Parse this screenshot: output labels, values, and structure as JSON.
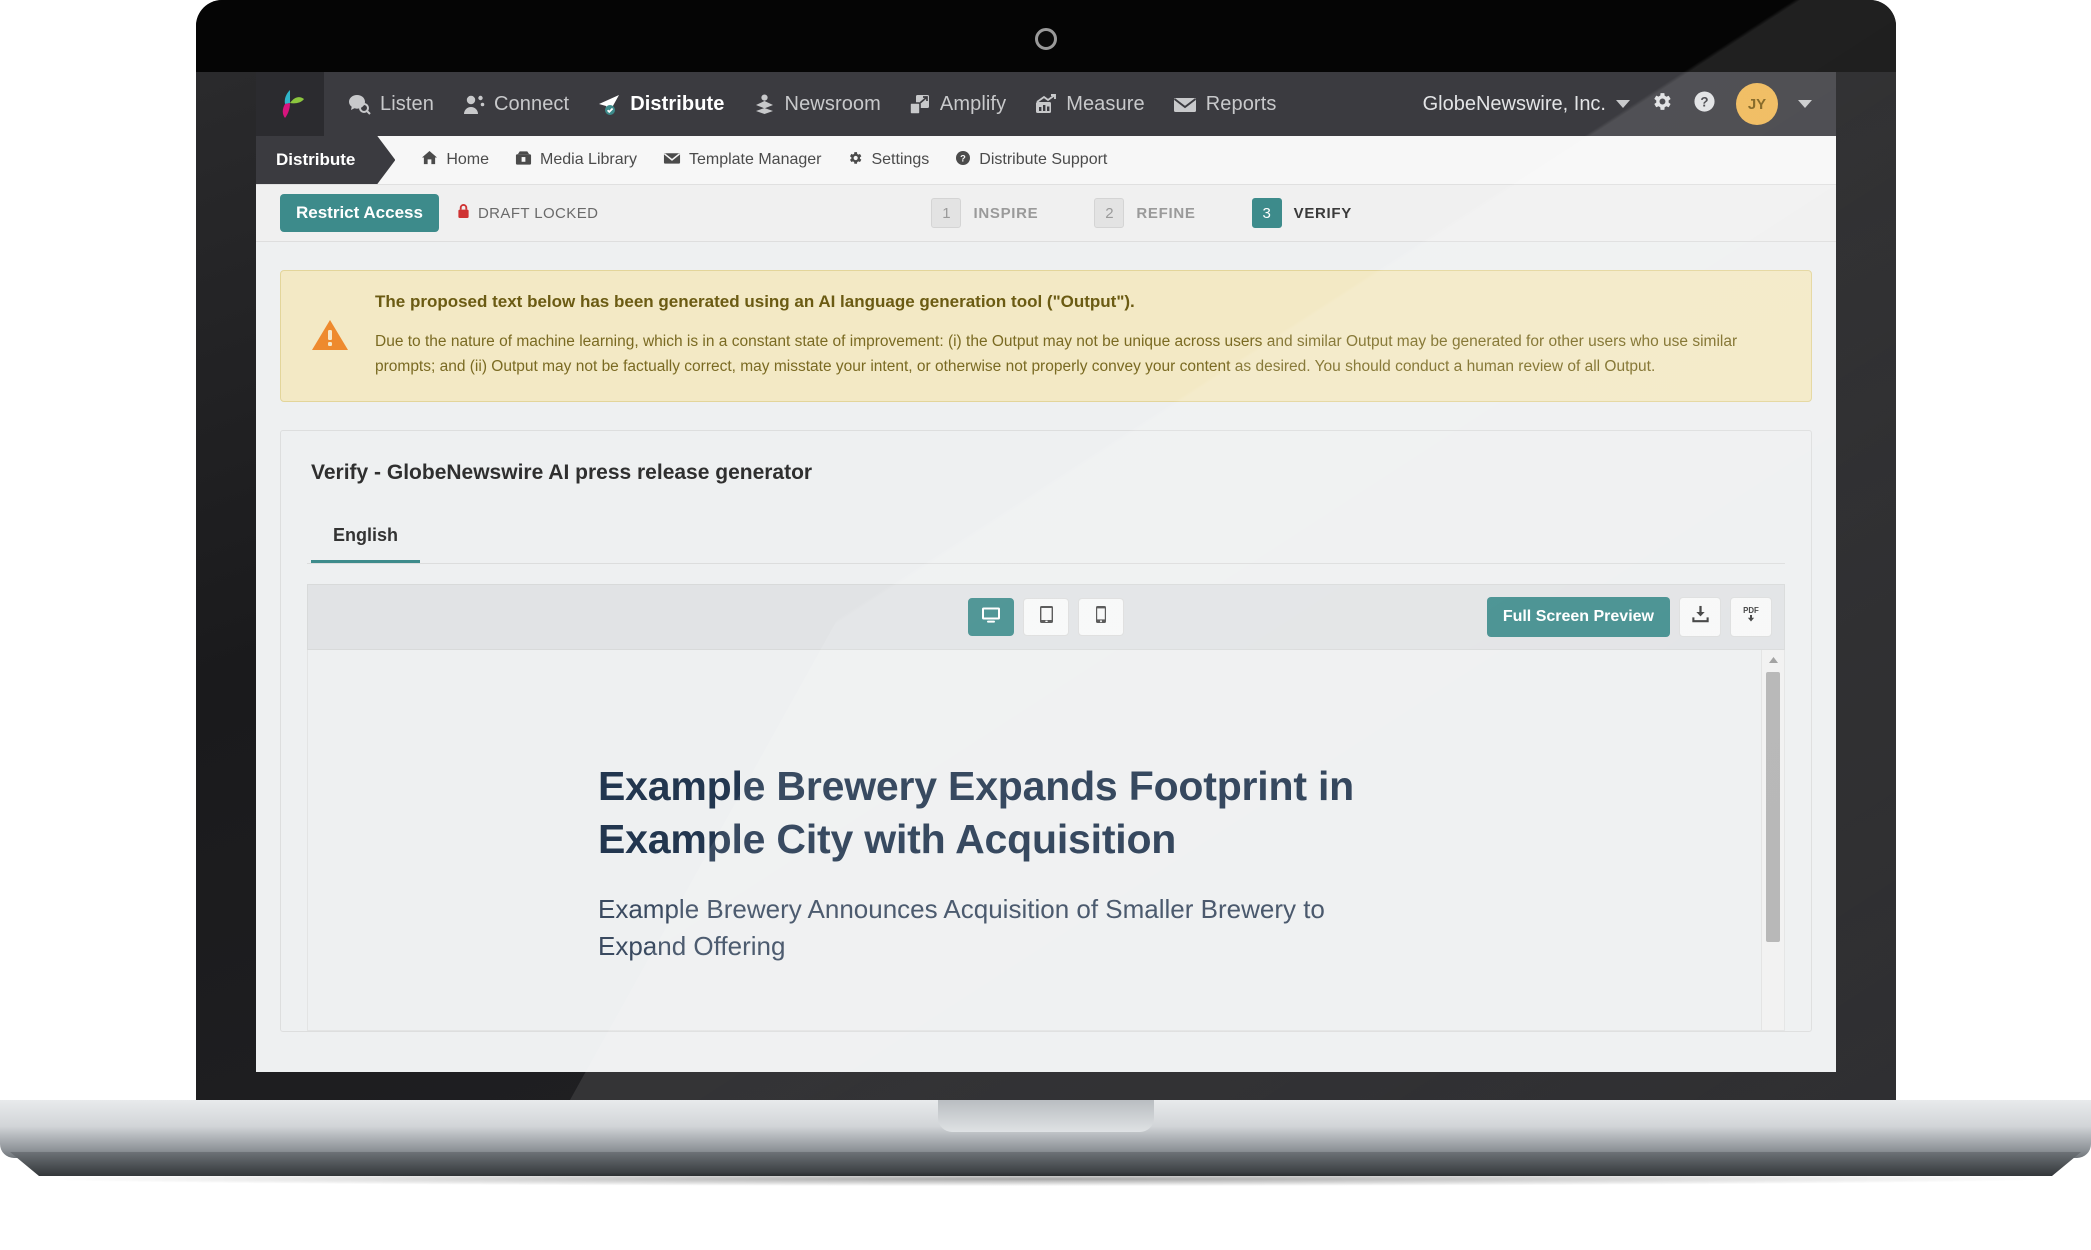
{
  "topnav": {
    "logo_icon": "globenewswire-logo-icon",
    "items": [
      {
        "label": "Listen",
        "icon": "listen-search-icon",
        "active": false
      },
      {
        "label": "Connect",
        "icon": "connect-people-icon",
        "active": false
      },
      {
        "label": "Distribute",
        "icon": "distribute-paperplane-icon",
        "active": true
      },
      {
        "label": "Newsroom",
        "icon": "newsroom-layers-icon",
        "active": false
      },
      {
        "label": "Amplify",
        "icon": "amplify-expand-icon",
        "active": false
      },
      {
        "label": "Measure",
        "icon": "measure-chart-icon",
        "active": false
      },
      {
        "label": "Reports",
        "icon": "reports-envelope-icon",
        "active": false
      }
    ],
    "org_name": "GlobeNewswire, Inc.",
    "settings_icon": "gear-icon",
    "help_icon": "question-circle-icon",
    "avatar_initials": "JY",
    "avatar_color": "#efb754",
    "user_caret_icon": "caret-down-icon"
  },
  "subnav": {
    "section_tag": "Distribute",
    "links": [
      {
        "label": "Home",
        "icon": "home-icon"
      },
      {
        "label": "Media Library",
        "icon": "media-library-icon"
      },
      {
        "label": "Template Manager",
        "icon": "envelope-icon"
      },
      {
        "label": "Settings",
        "icon": "gear-icon"
      },
      {
        "label": "Distribute Support",
        "icon": "question-circle-icon"
      }
    ]
  },
  "stepbar": {
    "restrict_access_label": "Restrict Access",
    "draft_status": "DRAFT LOCKED",
    "draft_lock_icon": "lock-icon",
    "steps": [
      {
        "number": "1",
        "label": "INSPIRE",
        "active": false
      },
      {
        "number": "2",
        "label": "REFINE",
        "active": false
      },
      {
        "number": "3",
        "label": "VERIFY",
        "active": true
      }
    ],
    "accent_color": "#3d8b8b"
  },
  "alert": {
    "icon": "warning-triangle-icon",
    "title": "The proposed text below has been generated using an AI language generation tool (\"Output\").",
    "body": "Due to the nature of machine learning, which is in a constant state of improvement: (i) the Output may not be unique across users and similar Output may be generated for other users who use similar prompts; and (ii) Output may not be factually correct, may misstate your intent, or otherwise not properly convey your content as desired. You should conduct a human review of all Output.",
    "background_color": "#f3e9c5"
  },
  "card": {
    "title": "Verify - GlobeNewswire AI press release generator",
    "tabs": [
      {
        "label": "English",
        "active": true
      }
    ]
  },
  "toolbar": {
    "devices": [
      {
        "name": "desktop",
        "icon": "desktop-monitor-icon",
        "active": true
      },
      {
        "name": "tablet",
        "icon": "tablet-icon",
        "active": false
      },
      {
        "name": "mobile",
        "icon": "mobile-phone-icon",
        "active": false
      }
    ],
    "fullscreen_label": "Full Screen Preview",
    "download_icon": "download-icon",
    "pdf_icon": "pdf-download-icon",
    "pdf_label": "PDF"
  },
  "press_release": {
    "headline": "Example Brewery Expands Footprint in Example City with Acquisition",
    "subheadline": "Example Brewery Announces Acquisition of Smaller Brewery to Expand Offering"
  },
  "scrollbar": {
    "up_arrow_icon": "scroll-up-arrow-icon"
  }
}
